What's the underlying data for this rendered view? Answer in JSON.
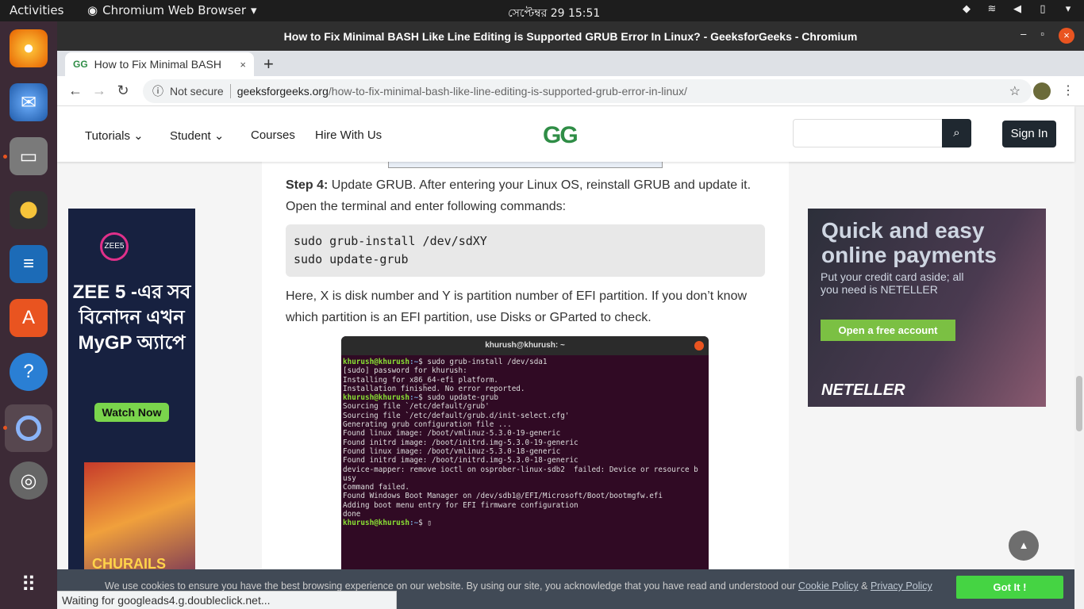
{
  "topbar": {
    "activities": "Activities",
    "app": "Chromium Web Browser",
    "clock": "সেপ্টেম্বর 29  15:51"
  },
  "window": {
    "title": "How to Fix Minimal BASH Like Line Editing is Supported GRUB Error In Linux? - GeeksforGeeks - Chromium"
  },
  "tab": {
    "title": "How to Fix Minimal BASH",
    "close": "×",
    "new": "+"
  },
  "address": {
    "security": "Not secure",
    "host": "geeksforgeeks.org",
    "path": "/how-to-fix-minimal-bash-like-line-editing-is-supported-grub-error-in-linux/"
  },
  "header": {
    "menu": [
      "Tutorials",
      "Student",
      "Courses",
      "Hire With Us"
    ],
    "logo": "GG",
    "signin": "Sign In"
  },
  "article": {
    "step_label": "Step 4:",
    "step_text": " Update GRUB. After entering your Linux OS, reinstall GRUB and update it. Open the terminal and enter following commands:",
    "code": "sudo grub-install /dev/sdXY\nsudo update-grub",
    "para2": "Here, X is disk number and Y is partition number of EFI partition. If you don’t know which partition is an EFI partition, use Disks or GParted to check.",
    "terminal_title": "khurush@khurush: ~",
    "terminal_lines": [
      "[sudo] password for khurush:",
      "Installing for x86_64-efi platform.",
      "Installation finished. No error reported.",
      "Sourcing file `/etc/default/grub'",
      "Sourcing file `/etc/default/grub.d/init-select.cfg'",
      "Generating grub configuration file ...",
      "Found linux image: /boot/vmlinuz-5.3.0-19-generic",
      "Found initrd image: /boot/initrd.img-5.3.0-19-generic",
      "Found linux image: /boot/vmlinuz-5.3.0-18-generic",
      "Found initrd image: /boot/initrd.img-5.3.0-18-generic",
      "device-mapper: remove ioctl on osprober-linux-sdb2  failed: Device or resource b",
      "usy",
      "Command failed.",
      "Found Windows Boot Manager on /dev/sdb1@/EFI/Microsoft/Boot/bootmgfw.efi",
      "Adding boot menu entry for EFI firmware configuration",
      "done"
    ],
    "prompt_user": "khurush@khurush",
    "prompt_path": ":~",
    "cmd1": "$ sudo grub-install /dev/sda1",
    "cmd2": "$ sudo update-grub",
    "cmd3": "$ "
  },
  "ad_left": {
    "brand": "ZEE5",
    "headline": "ZEE 5 -এর সব বিনোদন এখন MyGP অ্যাপে",
    "cta": "Watch Now",
    "movie": "CHURAILS"
  },
  "ad_right": {
    "headline": "Quick and easy online payments",
    "sub": "Put your credit card aside; all you need is NETELLER",
    "cta": "Open a free account",
    "brand": "NETELLER"
  },
  "cookie": {
    "text": "We use cookies to ensure you have the best browsing experience on our website. By using our site, you acknowledge that you have read and understood our ",
    "policy": "Cookie Policy",
    "amp": " & ",
    "privacy": "Privacy Policy",
    "button": "Got It !"
  },
  "status": "Waiting for googleads4.g.doubleclick.net..."
}
